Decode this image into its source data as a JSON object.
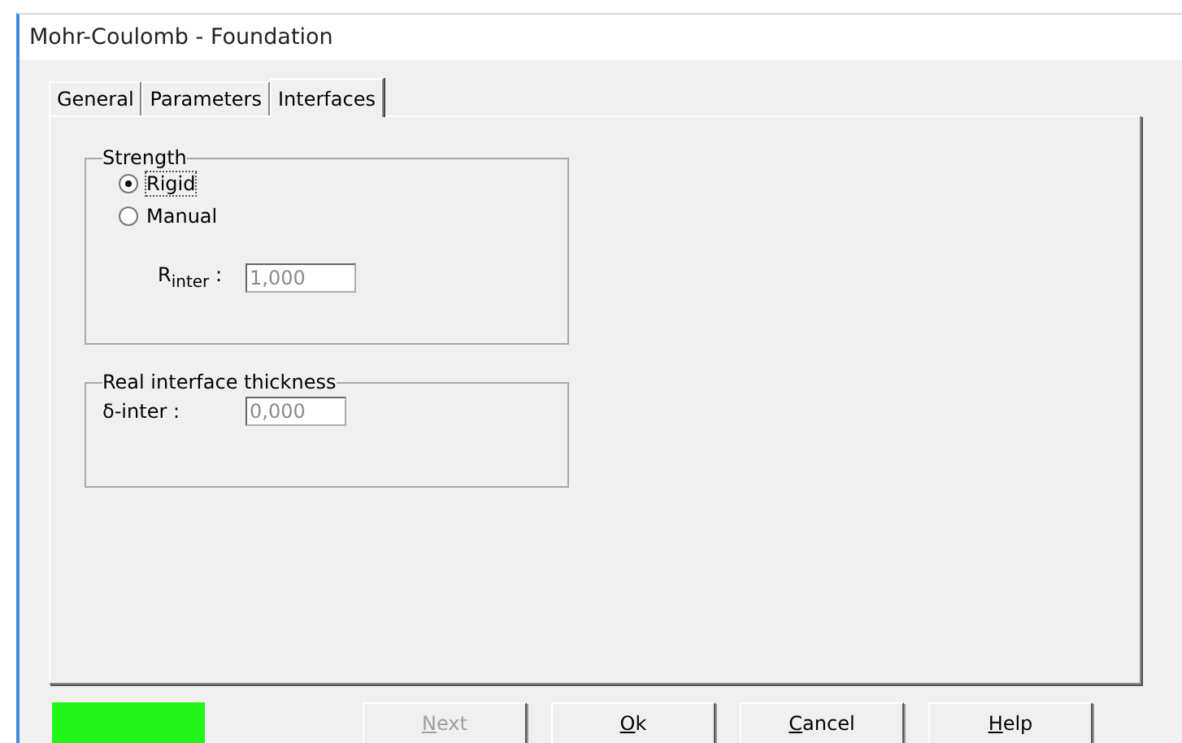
{
  "window": {
    "title": "Mohr-Coulomb - Foundation"
  },
  "tabs": [
    {
      "label": "General",
      "selected": false
    },
    {
      "label": "Parameters",
      "selected": false
    },
    {
      "label": "Interfaces",
      "selected": true
    }
  ],
  "strength": {
    "title": "Strength",
    "options": [
      {
        "label": "Rigid",
        "selected": true
      },
      {
        "label": "Manual",
        "selected": false
      }
    ],
    "field": {
      "label": "R$_{inter}$ :",
      "value": "1,000",
      "disabled": true
    }
  },
  "thickness": {
    "title": "Real interface thickness",
    "field": {
      "label": "δ-inter :",
      "value": "0,000",
      "disabled": true
    }
  },
  "status_swatch": {
    "color": "#22f51a"
  },
  "buttons": [
    {
      "label": "Next",
      "disabled": true
    },
    {
      "label": "Ok",
      "disabled": false
    },
    {
      "label": "Cancel",
      "disabled": false
    },
    {
      "label": "Help",
      "disabled": false
    }
  ]
}
